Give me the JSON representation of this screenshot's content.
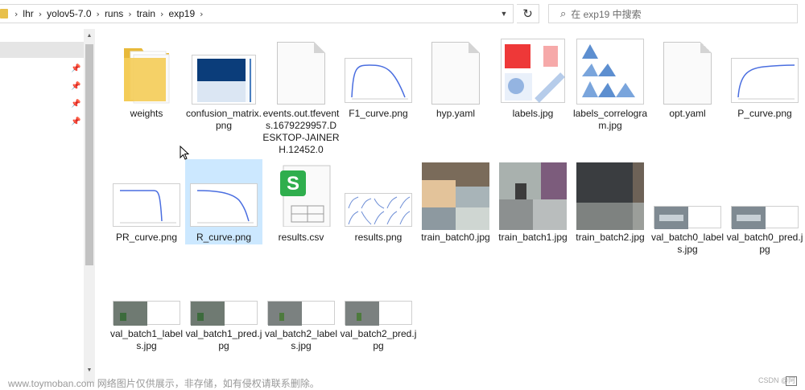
{
  "breadcrumb": [
    "lhr",
    "yolov5-7.0",
    "runs",
    "train",
    "exp19"
  ],
  "search": {
    "placeholder": "在 exp19 中搜索"
  },
  "files": [
    {
      "name": "weights",
      "kind": "folder"
    },
    {
      "name": "confusion_matrix.png",
      "kind": "matrix"
    },
    {
      "name": "events.out.tfevents.1679229957.DESKTOP-JAINERH.12452.0",
      "kind": "doc"
    },
    {
      "name": "F1_curve.png",
      "kind": "curve"
    },
    {
      "name": "hyp.yaml",
      "kind": "doc"
    },
    {
      "name": "labels.jpg",
      "kind": "labels"
    },
    {
      "name": "labels_correlogram.jpg",
      "kind": "correlogram"
    },
    {
      "name": "opt.yaml",
      "kind": "doc"
    },
    {
      "name": "P_curve.png",
      "kind": "curve"
    },
    {
      "name": "PR_curve.png",
      "kind": "curve"
    },
    {
      "name": "R_curve.png",
      "kind": "curve",
      "selected": true
    },
    {
      "name": "results.csv",
      "kind": "csv"
    },
    {
      "name": "results.png",
      "kind": "results"
    },
    {
      "name": "train_batch0.jpg",
      "kind": "photo"
    },
    {
      "name": "train_batch1.jpg",
      "kind": "photo"
    },
    {
      "name": "train_batch2.jpg",
      "kind": "photo"
    },
    {
      "name": "val_batch0_labels.jpg",
      "kind": "val"
    },
    {
      "name": "val_batch0_pred.jpg",
      "kind": "val"
    },
    {
      "name": "val_batch1_labels.jpg",
      "kind": "val"
    },
    {
      "name": "val_batch1_pred.jpg",
      "kind": "val"
    },
    {
      "name": "val_batch2_labels.jpg",
      "kind": "val"
    },
    {
      "name": "val_batch2_pred.jpg",
      "kind": "val"
    }
  ],
  "watermark": "www.toymoban.com 网络图片仅供展示，非存储，如有侵权请联系删除。",
  "watermark_right": "CSDN @阿"
}
